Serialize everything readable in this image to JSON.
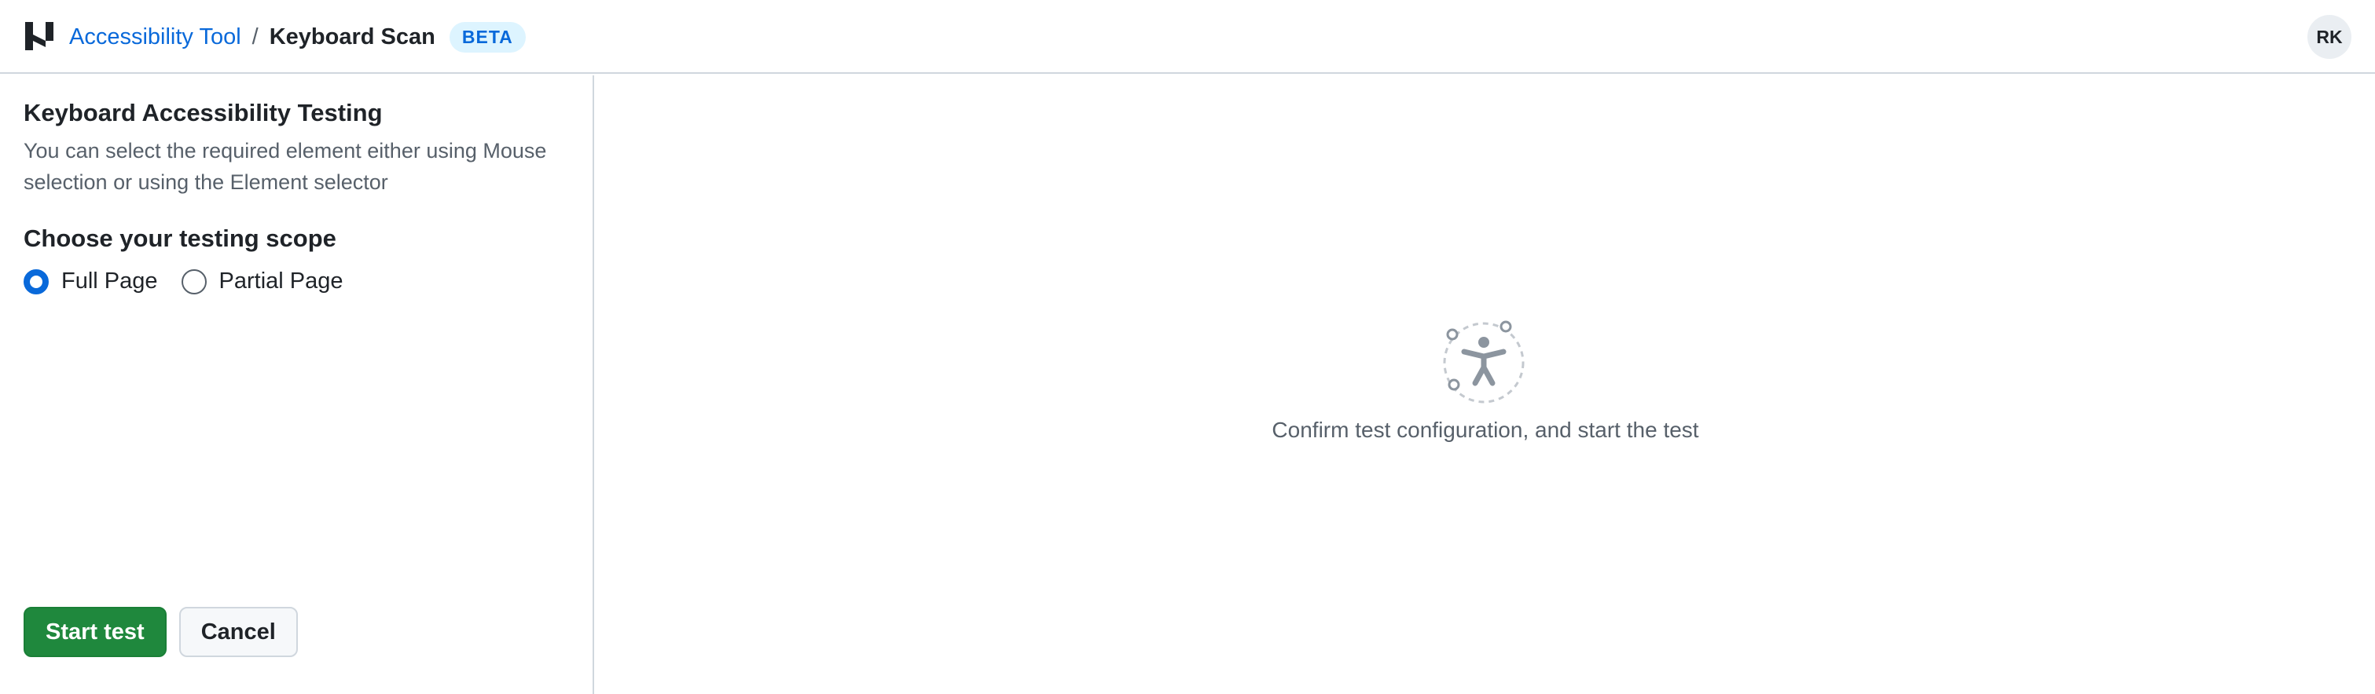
{
  "header": {
    "breadcrumb": {
      "root_label": "Accessibility Tool",
      "separator": "/",
      "current_label": "Keyboard Scan",
      "badge": "BETA"
    },
    "avatar_initials": "RK",
    "logo_icon": "brand-logo-icon"
  },
  "left_panel": {
    "title": "Keyboard Accessibility Testing",
    "description": "You can select the required element either using Mouse selection or using the Element selector",
    "scope_title": "Choose your testing scope",
    "scope_options": [
      {
        "label": "Full Page",
        "selected": true
      },
      {
        "label": "Partial Page",
        "selected": false
      }
    ],
    "start_button": "Start test",
    "cancel_button": "Cancel"
  },
  "right_panel": {
    "empty_icon": "accessibility-icon",
    "empty_message": "Confirm test configuration, and start the test"
  },
  "colors": {
    "accent": "#0969da",
    "primary_button": "#1f883d",
    "badge_bg": "#ddf4ff",
    "border": "#d0d7de"
  }
}
